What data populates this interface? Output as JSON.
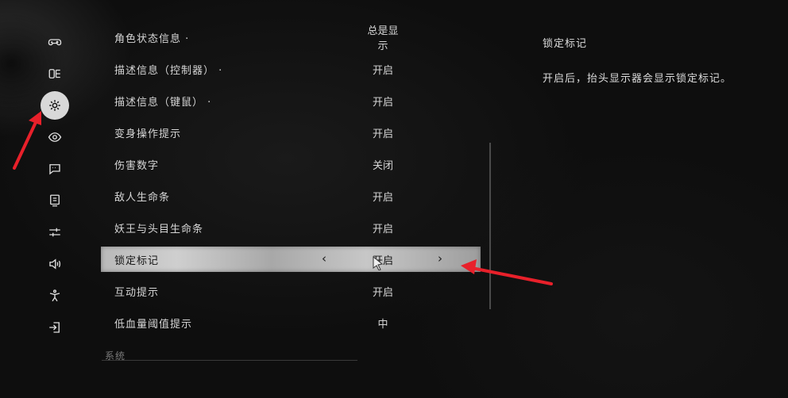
{
  "sidebar": {
    "icons": [
      {
        "name": "gamepad-icon"
      },
      {
        "name": "controller-layout-icon"
      },
      {
        "name": "gear-icon"
      },
      {
        "name": "eye-icon"
      },
      {
        "name": "chat-icon"
      },
      {
        "name": "monitor-icon"
      },
      {
        "name": "sliders-icon"
      },
      {
        "name": "speaker-icon"
      },
      {
        "name": "accessibility-icon"
      },
      {
        "name": "exit-icon"
      }
    ],
    "active_index": 2
  },
  "settings": [
    {
      "label": "角色状态信息 ·",
      "value": "总是显示"
    },
    {
      "label": "描述信息（控制器） ·",
      "value": "开启"
    },
    {
      "label": "描述信息（键鼠） ·",
      "value": "开启"
    },
    {
      "label": "变身操作提示",
      "value": "开启"
    },
    {
      "label": "伤害数字",
      "value": "关闭"
    },
    {
      "label": "敌人生命条",
      "value": "开启"
    },
    {
      "label": "妖王与头目生命条",
      "value": "开启"
    },
    {
      "label": "锁定标记",
      "value": "开启",
      "selected": true,
      "left_arrow": "‹",
      "right_arrow": "›"
    },
    {
      "label": "互动提示",
      "value": "开启"
    },
    {
      "label": "低血量阈值提示",
      "value": "中"
    }
  ],
  "section": {
    "label": "系统"
  },
  "description": {
    "title": "锁定标记",
    "body": "开启后，抬头显示器会显示锁定标记。"
  },
  "colors": {
    "annotation_red": "#e8202a",
    "selected_row": "#c4c4c4"
  }
}
